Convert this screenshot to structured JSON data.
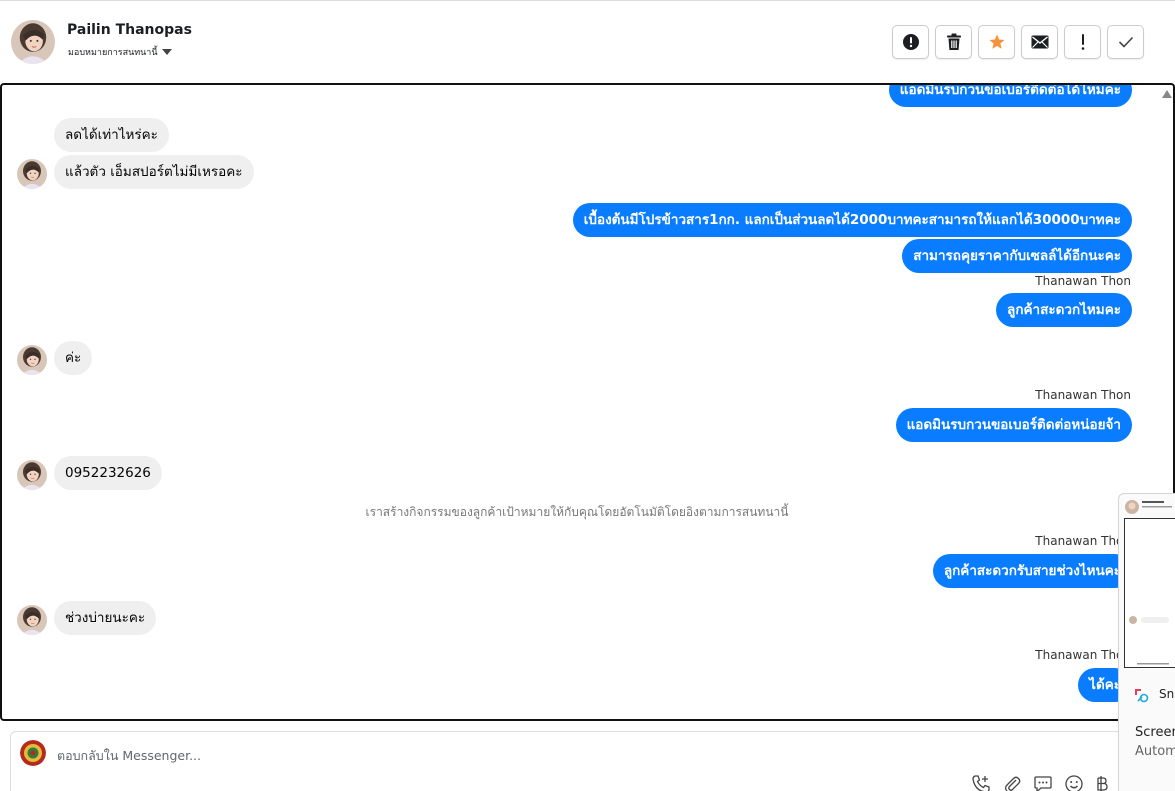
{
  "header": {
    "contact_name": "Pailin Thanopas",
    "assign_label": "มอบหมายการสนทนานี้",
    "toolbar_icons": [
      "alert-circle-icon",
      "trash-icon",
      "star-icon",
      "envelope-icon",
      "exclamation-icon",
      "check-icon"
    ]
  },
  "conversation": {
    "messages": {
      "m0": "แอดมินรบกวนขอเบอร์ติดต่อได้ไหมคะ",
      "m1": "ลดได้เท่าไหร่คะ",
      "m2": "แล้วตัว เอ็มสปอร์ตไม่มีเหรอคะ",
      "m3": "เบื้องต้นมีโปรข้าวสาร1กก. แลกเป็นส่วนลดได้2000บาทคะสามารถให้แลกได้30000บาทคะ",
      "m4": "สามารถคุยราคากับเซลล์ได้อีกนะคะ",
      "m5": "ลูกค้าสะดวกไหมคะ",
      "m6": "ค่ะ",
      "m7": "แอดมินรบกวนขอเบอร์ติดต่อหน่อยจ้า",
      "m8": "0952232626",
      "m9": "ลูกค้าสะดวกรับสายช่วงไหนคะ",
      "m10": "ช่วงบ่ายนะคะ",
      "m11": "ได้คะ"
    },
    "sender_name": "Thanawan Thon",
    "system_note": "เราสร้างกิจกรรมของลูกค้าเป้าหมายให้กับคุณโดยอัตโนมัติโดยอิงตามการสนทนานี้"
  },
  "composer": {
    "placeholder": "ตอบกลับใน Messenger...",
    "icons": [
      "phone-plus-icon",
      "paperclip-icon",
      "saved-reply-icon",
      "emoji-icon",
      "baht-icon"
    ]
  },
  "overlay": {
    "app_label": "Sni",
    "title": "Screen",
    "subtitle": "Autom"
  },
  "colors": {
    "outgoing_bubble": "#0a7cff",
    "incoming_bubble": "#efefef",
    "star": "#f5923e"
  }
}
